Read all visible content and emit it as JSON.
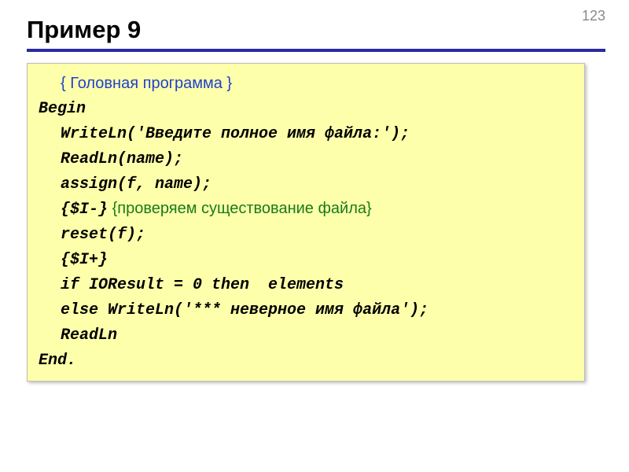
{
  "page_number": "123",
  "title": "Пример 9",
  "code": {
    "c0": "{ Головная программа }",
    "c1": "Begin",
    "c2": "WriteLn('Введите полное имя файла:');",
    "c3": "ReadLn(name);",
    "c4": "assign(f, name);",
    "c5a": "{$I-}",
    "c5b": "{проверяем существование файла}",
    "c6": "reset(f);",
    "c7": "{$I+}",
    "c8": "if IOResult = 0 then  elements",
    "c9": "else WriteLn('*** неверное имя файла');",
    "c10": "ReadLn",
    "c11": "End."
  }
}
